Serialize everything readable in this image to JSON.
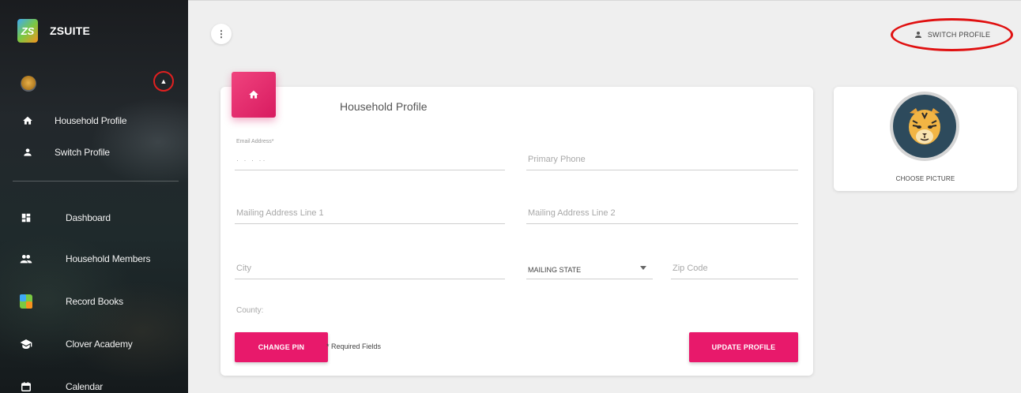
{
  "app": {
    "name": "ZSUITE",
    "logo_text": "ZS"
  },
  "sidebar": {
    "profile_items": [
      {
        "label": "Household Profile",
        "icon": "home-icon"
      },
      {
        "label": "Switch Profile",
        "icon": "person-icon"
      }
    ],
    "nav_items": [
      {
        "label": "Dashboard",
        "icon": "dashboard-icon"
      },
      {
        "label": "Household Members",
        "icon": "people-icon"
      },
      {
        "label": "Record Books",
        "icon": "zs-logo-icon"
      },
      {
        "label": "Clover Academy",
        "icon": "graduation-cap-icon"
      },
      {
        "label": "Calendar",
        "icon": "calendar-icon"
      }
    ]
  },
  "header": {
    "switch_profile_label": "SWITCH PROFILE"
  },
  "form": {
    "title": "Household Profile",
    "email_label": "Email Address*",
    "email_value": "·  ·  ·  ··",
    "primary_phone_placeholder": "Primary Phone",
    "mailing1_placeholder": "Mailing Address Line 1",
    "mailing2_placeholder": "Mailing Address Line 2",
    "city_placeholder": "City",
    "mailing_state_label": "MAILING STATE",
    "zip_placeholder": "Zip Code",
    "county_label": "County:",
    "change_pin_label": "CHANGE PIN",
    "required_note": "* Required Fields",
    "update_label": "UPDATE PROFILE"
  },
  "picture": {
    "choose_label": "CHOOSE PICTURE"
  },
  "colors": {
    "accent": "#e8196b",
    "annotation": "#e01010"
  }
}
